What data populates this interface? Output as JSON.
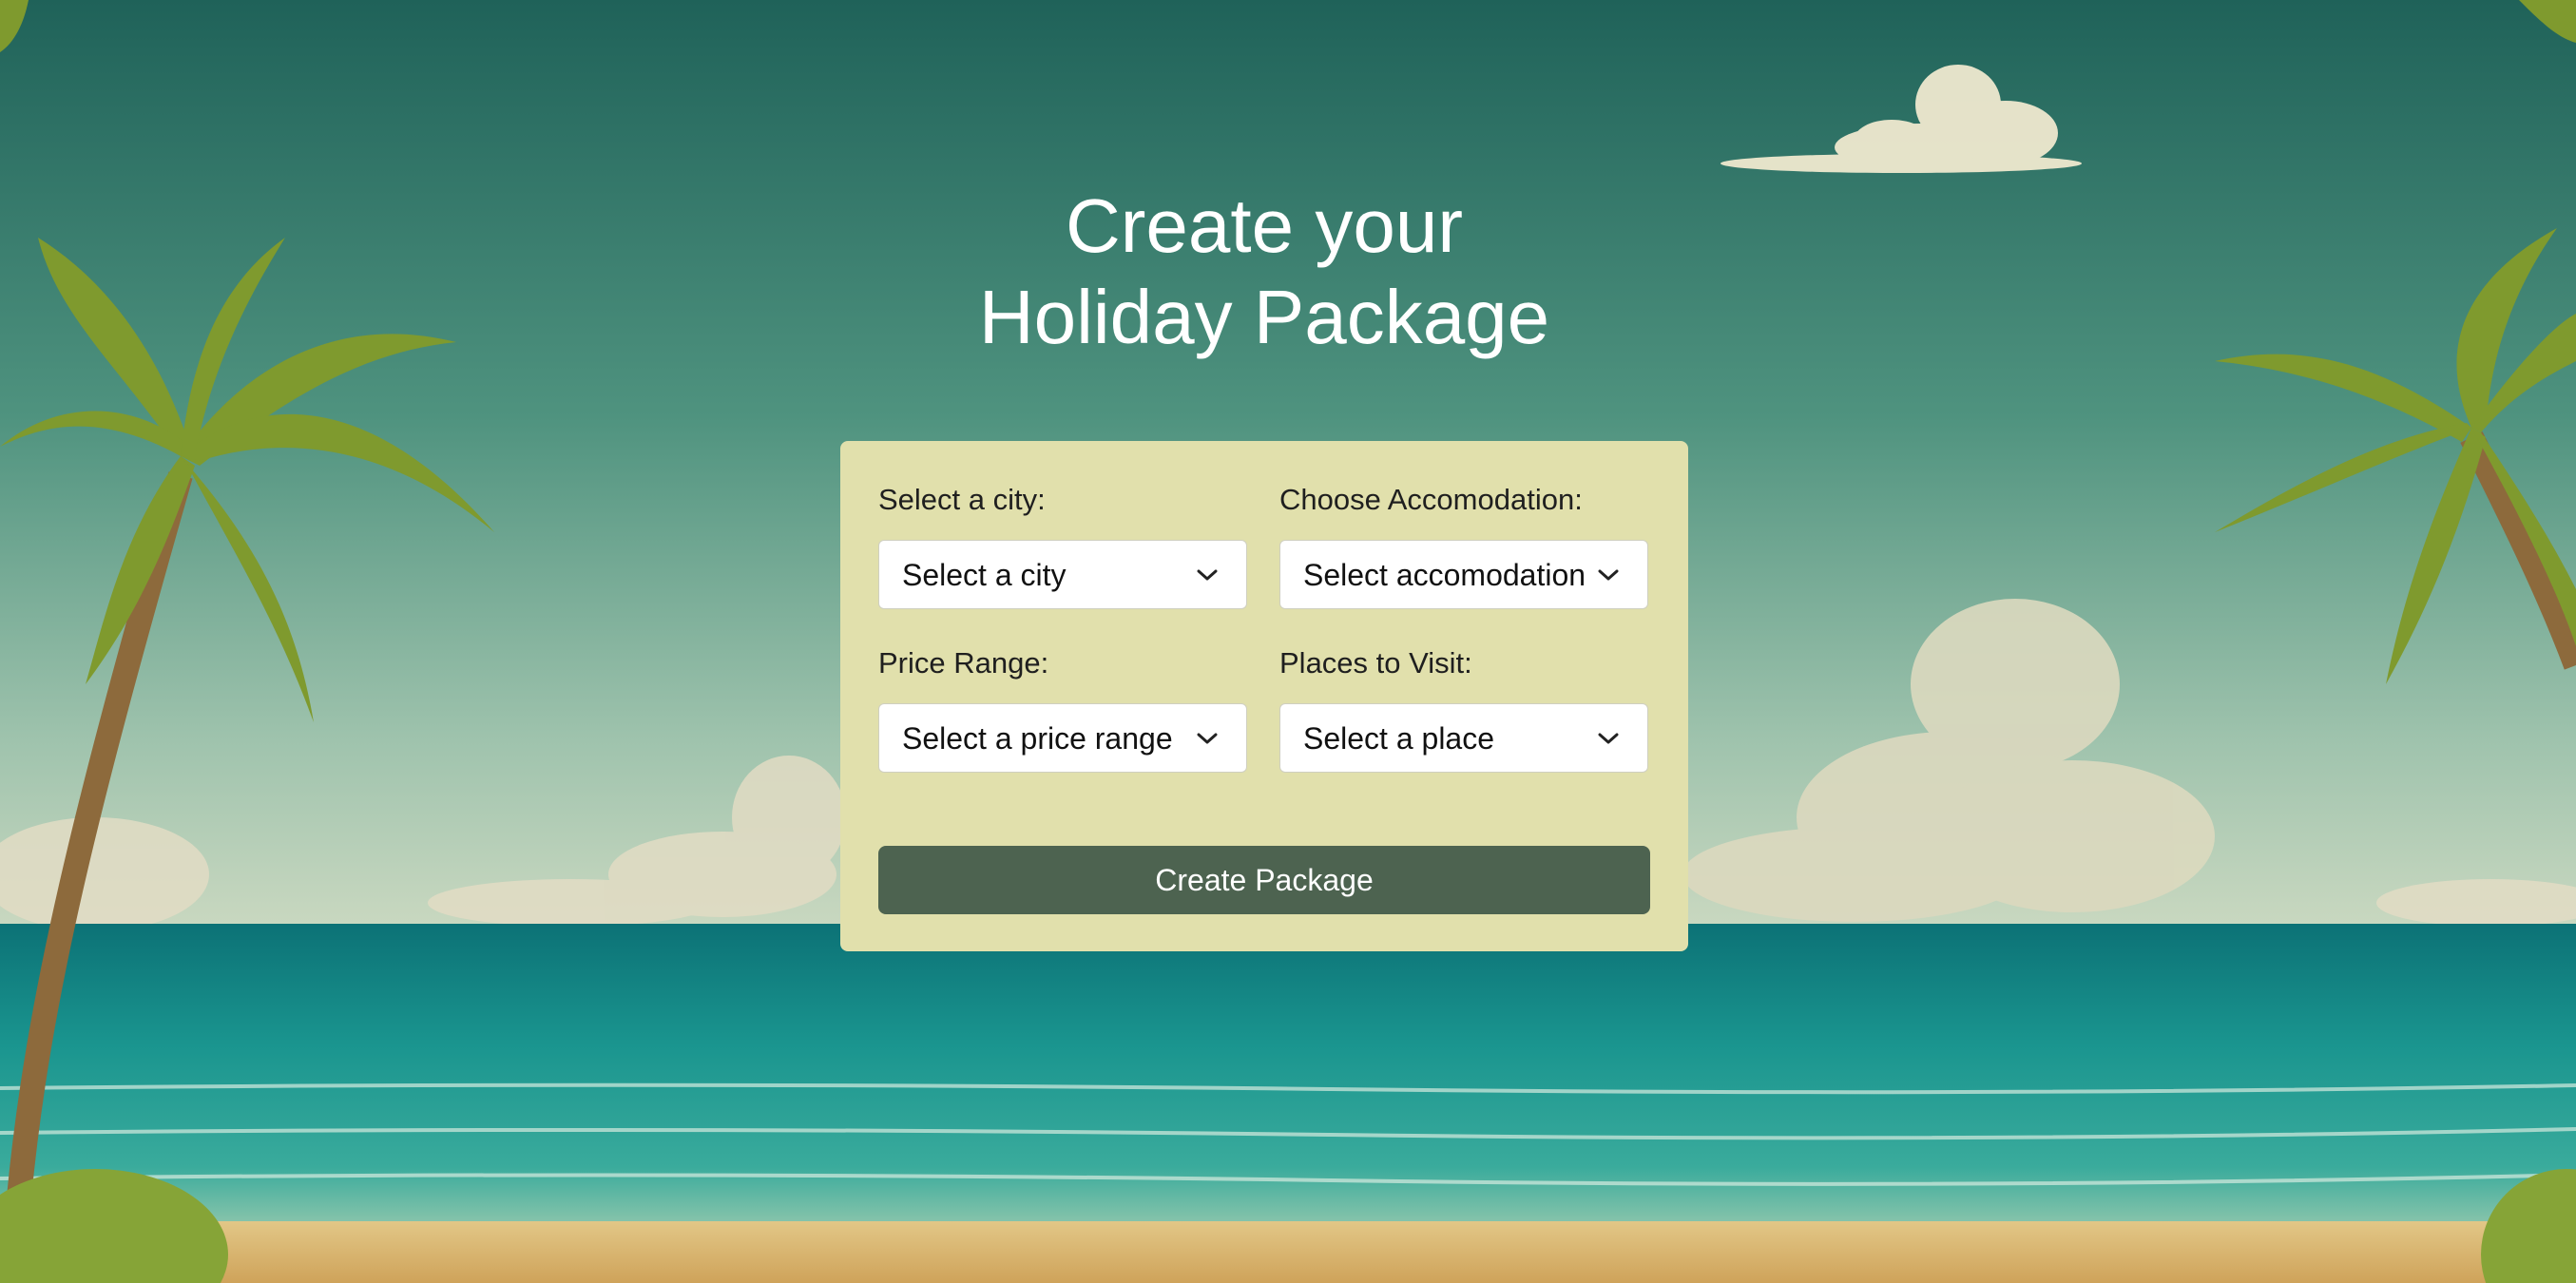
{
  "page": {
    "title_line1": "Create your",
    "title_line2": "Holiday Package"
  },
  "form": {
    "city": {
      "label": "Select a city:",
      "value": "Select a city"
    },
    "accommodation": {
      "label": "Choose Accomodation:",
      "value": "Select accomodation"
    },
    "price_range": {
      "label": "Price Range:",
      "value": "Select a price range"
    },
    "places": {
      "label": "Places to Visit:",
      "value": "Select a place"
    },
    "submit_label": "Create Package"
  },
  "colors": {
    "card": "#e1e0ac",
    "button": "#4d6350",
    "sky": "#2e7a6a",
    "sea": "#1f9a90",
    "sand": "#d7b36c"
  },
  "icons": {
    "dropdown": "chevron-down-icon"
  }
}
